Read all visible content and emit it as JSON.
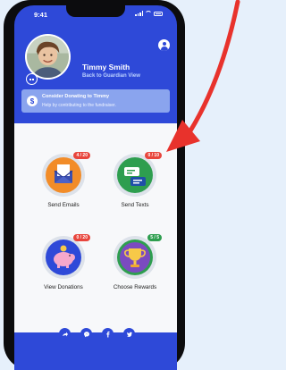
{
  "status_bar": {
    "time": "9:41"
  },
  "profile": {
    "name": "Timmy Smith",
    "back_link": "Back to Guardian View"
  },
  "banner": {
    "icon_letter": "$",
    "title": "Consider Donating to Timmy",
    "subtitle": "Help by contributing to the fundraiser."
  },
  "tiles": [
    {
      "label": "Send Emails",
      "counter": "4 / 20",
      "icon": "envelope-icon",
      "ring_color": "#f28c28",
      "counter_color": "#e8453c"
    },
    {
      "label": "Send Texts",
      "counter": "0 / 10",
      "icon": "chat-bubbles-icon",
      "ring_color": "#2e9e4f",
      "counter_color": "#e8453c"
    },
    {
      "label": "View Donations",
      "counter": "0 / 20",
      "icon": "piggy-bank-icon",
      "ring_color": "#2e49d8",
      "counter_color": "#e8453c"
    },
    {
      "label": "Choose Rewards",
      "counter": "5 / 5",
      "icon": "trophy-icon",
      "ring_color": "#7b4bc0",
      "counter_color": "#2e9e4f"
    }
  ],
  "share": {
    "icons": [
      "share-icon",
      "messenger-icon",
      "facebook-icon",
      "twitter-icon"
    ]
  },
  "colors": {
    "brand": "#2e49d8",
    "arrow": "#e8322c"
  }
}
